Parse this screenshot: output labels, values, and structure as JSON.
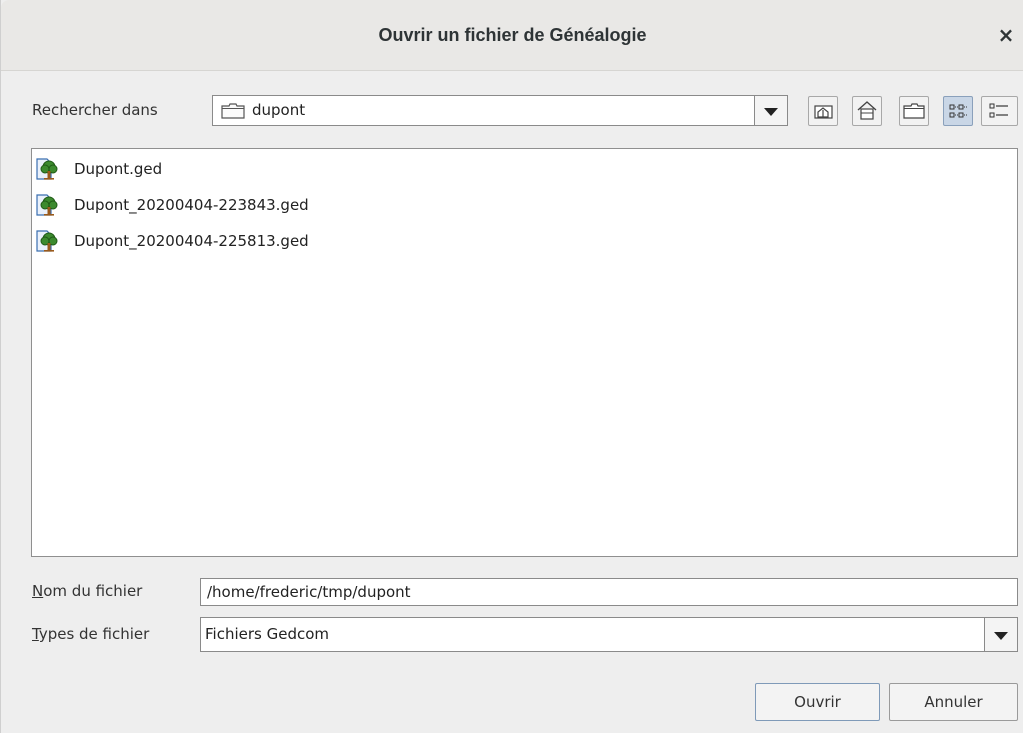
{
  "window": {
    "title": "Ouvrir un fichier de Généalogie",
    "close_glyph": "×"
  },
  "lookin": {
    "label": "Rechercher dans",
    "value": "dupont",
    "icon": "folder-icon"
  },
  "toolbar": [
    {
      "icon": "up-folder-icon"
    },
    {
      "icon": "home-icon"
    },
    {
      "icon": "new-folder-icon"
    },
    {
      "icon": "list-view-icon",
      "selected": true
    },
    {
      "icon": "details-view-icon",
      "selected": false
    }
  ],
  "files": [
    {
      "name": "Dupont.ged",
      "icon": "family-tree-icon"
    },
    {
      "name": "Dupont_20200404-223843.ged",
      "icon": "family-tree-icon"
    },
    {
      "name": "Dupont_20200404-225813.ged",
      "icon": "family-tree-icon"
    }
  ],
  "filename": {
    "label_mnemonic": "N",
    "label_rest": "om du fichier",
    "value": "/home/frederic/tmp/dupont"
  },
  "filetype": {
    "label_mnemonic": "T",
    "label_rest": "ypes de fichier",
    "value": "Fichiers Gedcom"
  },
  "buttons": {
    "open": "Ouvrir",
    "cancel": "Annuler"
  },
  "colors": {
    "accent_selected": "#c9d6e6",
    "tree_green": "#3c8a2e",
    "tree_trunk": "#9a5a1c",
    "file_blue": "#3b6fb0"
  }
}
